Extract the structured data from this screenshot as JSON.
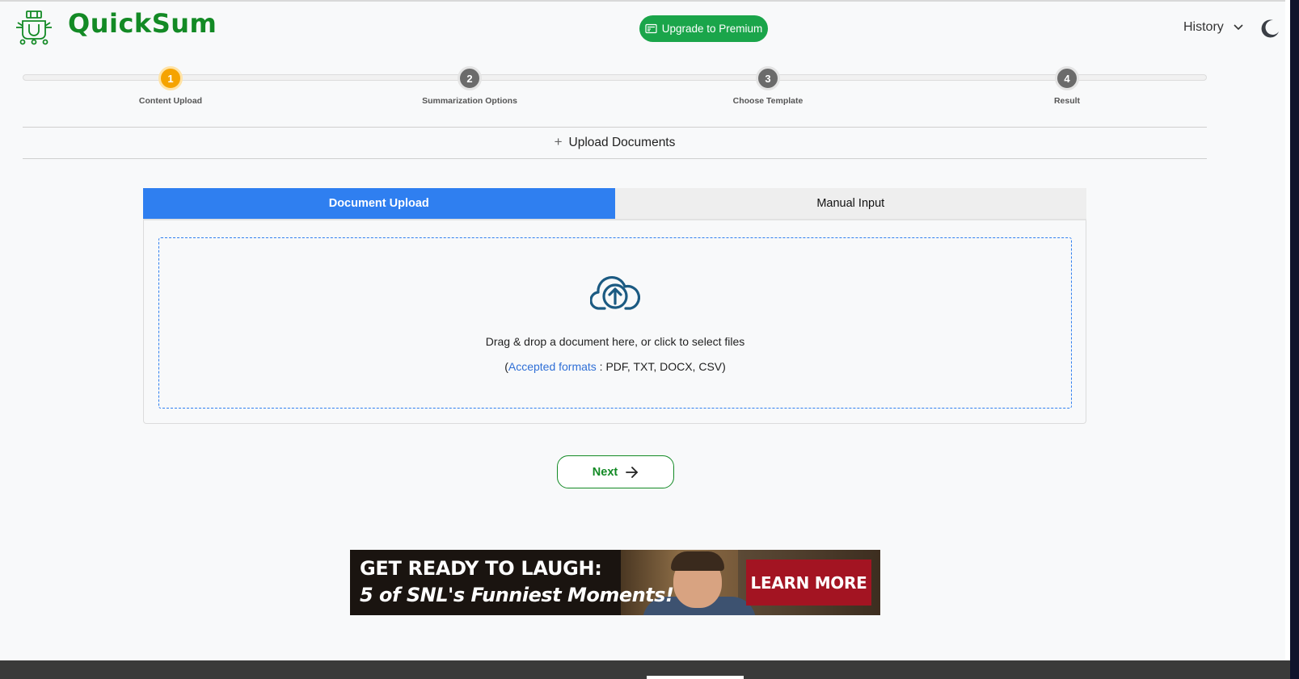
{
  "header": {
    "logo_text": "QuickSum",
    "premium_label": "Upgrade to Premium",
    "history_label": "History"
  },
  "stepper": {
    "current_step": 1,
    "steps": [
      {
        "number": "1",
        "label": "Content Upload"
      },
      {
        "number": "2",
        "label": "Summarization Options"
      },
      {
        "number": "3",
        "label": "Choose Template"
      },
      {
        "number": "4",
        "label": "Result"
      }
    ]
  },
  "section": {
    "title": "Upload Documents",
    "toggle_icon": "plus-icon"
  },
  "tabs": [
    {
      "label": "Document Upload",
      "active": true
    },
    {
      "label": "Manual Input",
      "active": false
    }
  ],
  "dropzone": {
    "icon": "cloud-upload-icon",
    "main_text": "Drag & drop a document here, or click to select files",
    "formats_prefix": "(",
    "formats_link": "Accepted formats",
    "formats_list": " : PDF, TXT, DOCX, CSV)"
  },
  "next_button": {
    "label": "Next",
    "icon": "arrow-right-icon"
  },
  "ad": {
    "headline_line1": "GET READY TO LAUGH:",
    "headline_line2": "5 of SNL's Funniest Moments!",
    "cta": "LEARN MORE"
  },
  "colors": {
    "brand_green": "#138a25",
    "premium_green": "#1aa54a",
    "accent_blue": "#2f7ff0",
    "step_active": "#f5a300",
    "step_inactive": "#6b6b6b",
    "ad_cta": "#a31422"
  }
}
